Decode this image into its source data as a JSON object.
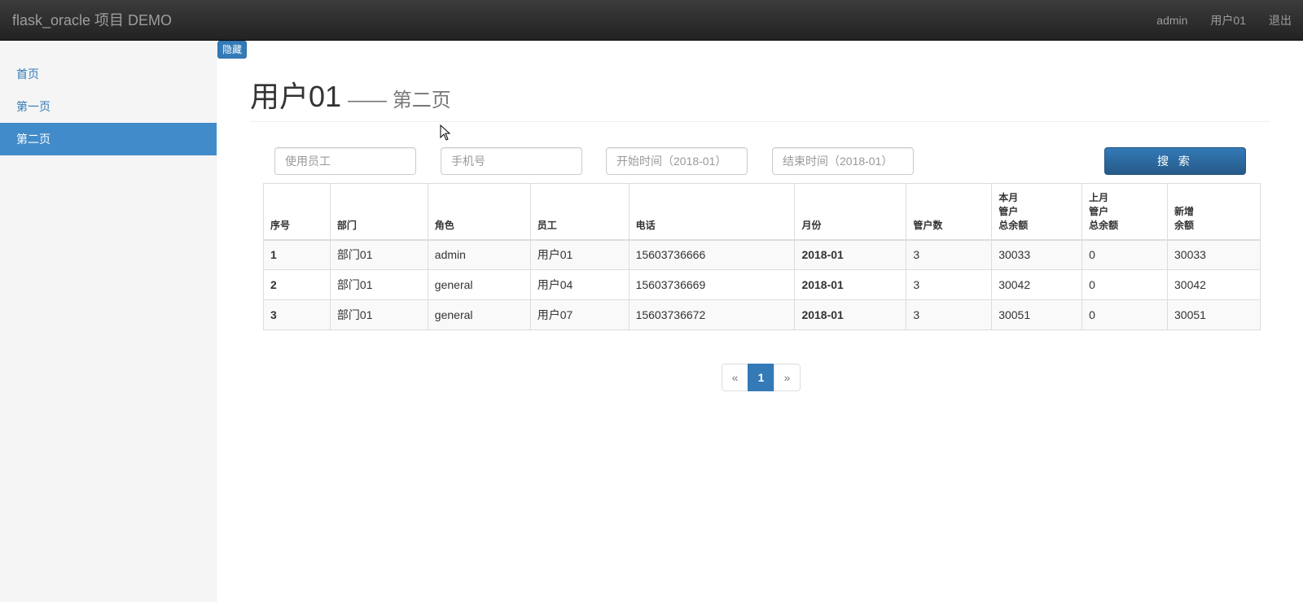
{
  "navbar": {
    "brand": "flask_oracle 项目 DEMO",
    "links": [
      "admin",
      "用户01",
      "退出"
    ]
  },
  "sidebar": {
    "items": [
      {
        "label": "首页",
        "active": false
      },
      {
        "label": "第一页",
        "active": false
      },
      {
        "label": "第二页",
        "active": true
      }
    ],
    "hide_label": "隐藏"
  },
  "header": {
    "title": "用户01",
    "subtitle": "—— 第二页"
  },
  "search": {
    "employee_placeholder": "使用员工",
    "phone_placeholder": "手机号",
    "start_placeholder": "开始时间（2018-01）",
    "end_placeholder": "结束时间（2018-01）",
    "button_label": "搜 索"
  },
  "table": {
    "columns": [
      "序号",
      "部门",
      "角色",
      "员工",
      "电话",
      "月份",
      "管户数",
      "本月\n管户\n总余额",
      "上月\n管户\n总余额",
      "新增\n余额"
    ],
    "rows": [
      [
        "1",
        "部门01",
        "admin",
        "用户01",
        "15603736666",
        "2018-01",
        "3",
        "30033",
        "0",
        "30033"
      ],
      [
        "2",
        "部门01",
        "general",
        "用户04",
        "15603736669",
        "2018-01",
        "3",
        "30042",
        "0",
        "30042"
      ],
      [
        "3",
        "部门01",
        "general",
        "用户07",
        "15603736672",
        "2018-01",
        "3",
        "30051",
        "0",
        "30051"
      ]
    ]
  },
  "pagination": {
    "prev": "«",
    "current": "1",
    "next": "»"
  },
  "colors": {
    "accent": "#337ab7",
    "sidebar_active": "#428bca",
    "navbar": "#222222"
  }
}
